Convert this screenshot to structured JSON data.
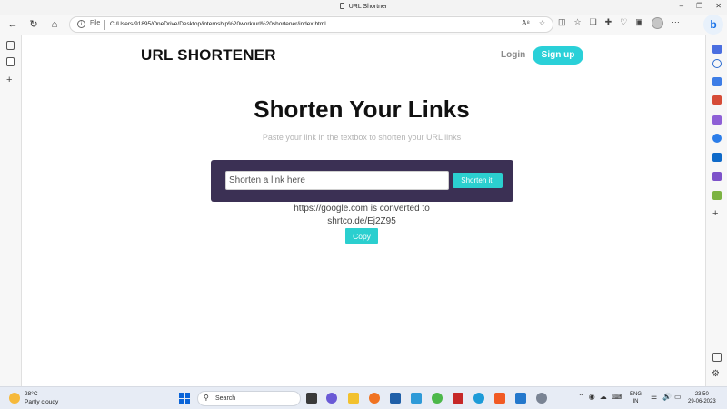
{
  "window": {
    "title": "URL Shortner"
  },
  "browser": {
    "file_label": "File",
    "url": "C:/Users/91895/OneDrive/Desktop/internship%20work/url%20shortener/index.html"
  },
  "page": {
    "brand": "URL SHORTENER",
    "login_label": "Login",
    "signup_label": "Sign up",
    "heading": "Shorten Your Links",
    "subheading": "Paste your link in the textbox to shorten your URL links",
    "input_placeholder": "Shorten a link here",
    "shorten_label": "Shorten it!",
    "result_line1": "https://google.com is converted to",
    "result_line2": "shrtco.de/Ej2Z95",
    "copy_label": "Copy"
  },
  "taskbar": {
    "temperature": "28°C",
    "weather": "Partly cloudy",
    "search_label": "Search",
    "lang_line1": "ENG",
    "lang_line2": "IN",
    "time": "23:50",
    "date": "29-06-2023"
  },
  "colors": {
    "accent": "#2bcfcf",
    "panel": "#3b3054"
  }
}
